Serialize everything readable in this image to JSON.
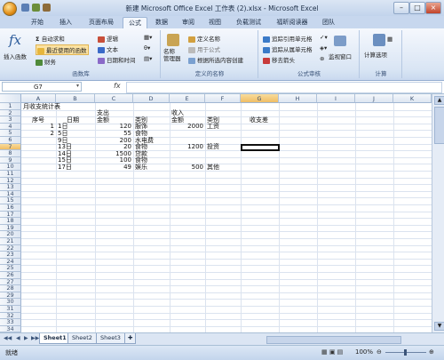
{
  "window": {
    "title": "新建 Microsoft Office Excel 工作表 (2).xlsx - Microsoft Excel"
  },
  "tabs": [
    "开始",
    "插入",
    "页面布局",
    "公式",
    "数据",
    "审阅",
    "视图",
    "负载测试",
    "福昕阅读器",
    "团队"
  ],
  "active_tab": "公式",
  "ribbon": {
    "insert_function": "插入函数",
    "autosum": "自动求和",
    "recently_used": "最近使用的函数",
    "financial": "财务",
    "logical": "逻辑",
    "text": "文本",
    "datetime": "日期和时间",
    "group_library": "函数库",
    "name_manager": "名称\n管理器",
    "define_name": "定义名称",
    "use_in_formula": "用于公式",
    "create_from_selection": "根据所选内容创建",
    "group_defined_names": "定义的名称",
    "trace_precedents": "追踪引用单元格",
    "trace_dependents": "追踪从属单元格",
    "remove_arrows": "移去箭头",
    "watch_window": "监视窗口",
    "group_auditing": "公式审核",
    "calc_options": "计算选项",
    "group_calculation": "计算"
  },
  "formula_bar": {
    "name_box": "G7",
    "fx": "fx",
    "value": ""
  },
  "columns": [
    "A",
    "B",
    "C",
    "D",
    "E",
    "F",
    "G",
    "H",
    "I",
    "J",
    "K"
  ],
  "selected_col": "G",
  "rows": [
    "1",
    "2",
    "3",
    "4",
    "5",
    "6",
    "7",
    "8",
    "9",
    "10",
    "11",
    "12",
    "13",
    "14",
    "15",
    "16",
    "17",
    "18",
    "19",
    "20",
    "21",
    "22",
    "23",
    "24",
    "25",
    "26",
    "27",
    "28",
    "29",
    "30",
    "31",
    "32",
    "33",
    "34"
  ],
  "selected_row": "7",
  "cells": {
    "A1": "月收支统计表",
    "C2": "支出",
    "E2": "收入",
    "A3": "序号",
    "B3": "日期",
    "C3": "金额",
    "D3": "类别",
    "E3": "金额",
    "F3": "类别",
    "G3": "收支差",
    "A4": "1",
    "B4": "1日",
    "C4": "120",
    "D4": "服饰",
    "E4": "2000",
    "F4": "工资",
    "A5": "2",
    "B5": "5日",
    "C5": "55",
    "D5": "食物",
    "B6": "9日",
    "C6": "200",
    "D6": "水电费",
    "B7": "13日",
    "C7": "20",
    "D7": "食物",
    "E7": "1200",
    "F7": "投资",
    "B8": "14日",
    "C8": "1500",
    "D8": "贷款",
    "B9": "15日",
    "C9": "100",
    "D9": "食物",
    "B10": "17日",
    "C10": "49",
    "D10": "娱乐",
    "E10": "500",
    "F10": "其他"
  },
  "sheets": [
    "Sheet1",
    "Sheet2",
    "Sheet3"
  ],
  "active_sheet": "Sheet1",
  "status": {
    "ready": "就绪",
    "zoom": "100%"
  },
  "colors": {
    "accent": "#2a5a9a",
    "selection_header": "#f0bd64"
  }
}
